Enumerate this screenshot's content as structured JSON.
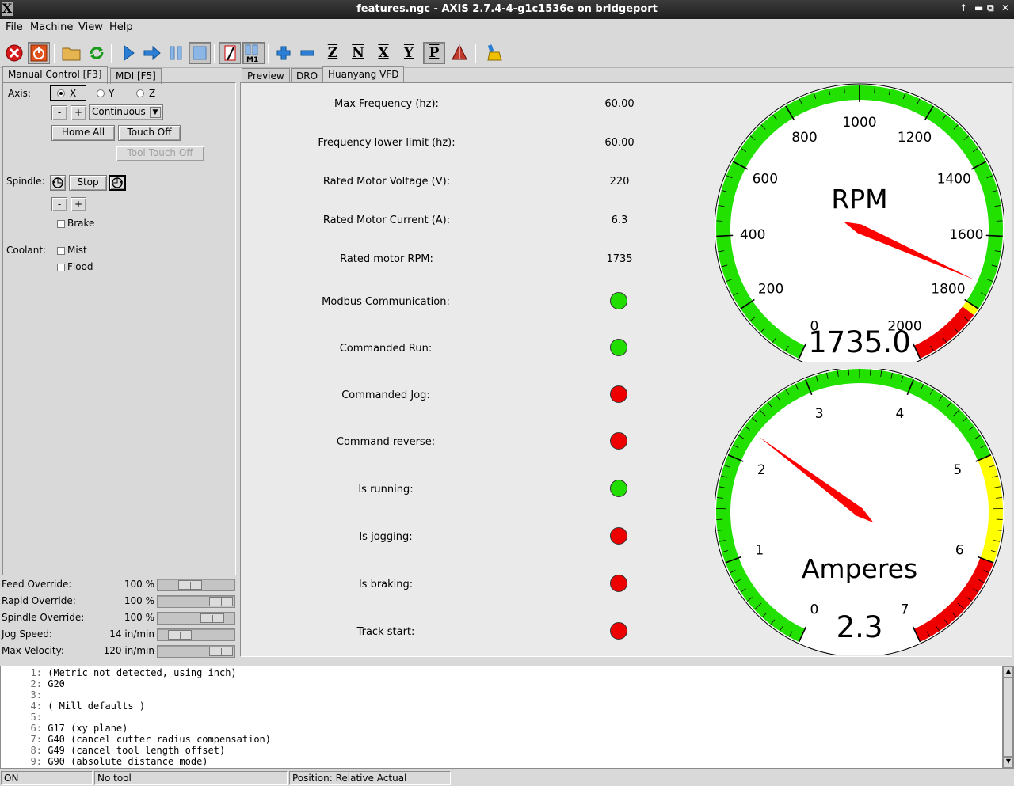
{
  "window": {
    "title": "features.ngc - AXIS 2.7.4-4-g1c1536e on bridgeport",
    "x_logo": "X"
  },
  "menu": [
    {
      "label": "File"
    },
    {
      "label": "Machine"
    },
    {
      "label": "View"
    },
    {
      "label": "Help"
    }
  ],
  "left_tabs": [
    {
      "label": "Manual Control [F3]"
    },
    {
      "label": "MDI [F5]"
    }
  ],
  "right_tabs": [
    {
      "label": "Preview"
    },
    {
      "label": "DRO"
    },
    {
      "label": "Huanyang VFD"
    }
  ],
  "manual": {
    "axis_label": "Axis:",
    "axes": [
      {
        "label": "X",
        "selected": true
      },
      {
        "label": "Y",
        "selected": false
      },
      {
        "label": "Z",
        "selected": false
      }
    ],
    "jog_minus": "-",
    "jog_plus": "+",
    "jog_mode": "Continuous",
    "home_all": "Home All",
    "touch_off": "Touch Off",
    "tool_touch_off": "Tool Touch Off",
    "spindle_label": "Spindle:",
    "spindle_stop": "Stop",
    "spindle_minus": "-",
    "spindle_plus": "+",
    "brake": "Brake",
    "coolant_label": "Coolant:",
    "mist": "Mist",
    "flood": "Flood"
  },
  "overrides": [
    {
      "label": "Feed Override:",
      "value": "100 %",
      "fraction": 0.4
    },
    {
      "label": "Rapid Override:",
      "value": "100 %",
      "fraction": 1.0
    },
    {
      "label": "Spindle Override:",
      "value": "100 %",
      "fraction": 0.83
    },
    {
      "label": "Jog Speed:",
      "value": "14 in/min",
      "fraction": 0.2
    },
    {
      "label": "Max Velocity:",
      "value": "120 in/min",
      "fraction": 1.0
    }
  ],
  "vfd": {
    "params": [
      {
        "label": "Max Frequency (hz):",
        "value": "60.00"
      },
      {
        "label": "Frequency lower limit (hz):",
        "value": "60.00"
      },
      {
        "label": "Rated Motor Voltage (V):",
        "value": "220"
      },
      {
        "label": "Rated Motor Current (A):",
        "value": "6.3"
      },
      {
        "label": "Rated motor RPM:",
        "value": "1735"
      }
    ],
    "leds": [
      {
        "label": "Modbus Communication:",
        "state": "on"
      },
      {
        "label": "Commanded Run:",
        "state": "on"
      },
      {
        "label": "Commanded Jog:",
        "state": "off"
      },
      {
        "label": "Command reverse:",
        "state": "off"
      },
      {
        "label": "Is running:",
        "state": "on"
      },
      {
        "label": "Is jogging:",
        "state": "off"
      },
      {
        "label": "Is braking:",
        "state": "off"
      },
      {
        "label": "Track start:",
        "state": "off"
      }
    ],
    "led_colors": {
      "on": "#22dd00",
      "off": "#ee0000"
    }
  },
  "gauges": {
    "rpm": {
      "title": "RPM",
      "readout": "1735.0",
      "value": 1735,
      "min": 0,
      "max": 2000,
      "major_step": 200,
      "minor_per_major": 5,
      "labels": [
        "0",
        "200",
        "400",
        "600",
        "800",
        "1000",
        "1200",
        "1400",
        "1600",
        "1800",
        "2000"
      ],
      "zones": [
        {
          "from": 0,
          "to": 1800,
          "color": "#22e000"
        },
        {
          "from": 1800,
          "to": 1820,
          "color": "#ffff00"
        },
        {
          "from": 1820,
          "to": 2000,
          "color": "#ee0000"
        }
      ]
    },
    "amps": {
      "title": "Amperes",
      "readout": "2.3",
      "value": 2.3,
      "min": 0,
      "max": 7,
      "major_step": 1,
      "minor_per_major": 10,
      "labels": [
        "0",
        "1",
        "2",
        "3",
        "4",
        "5",
        "6",
        "7"
      ],
      "zones": [
        {
          "from": 0,
          "to": 5,
          "color": "#22e000"
        },
        {
          "from": 5,
          "to": 6,
          "color": "#ffff00"
        },
        {
          "from": 6,
          "to": 7,
          "color": "#ee0000"
        }
      ]
    }
  },
  "gcode": [
    {
      "n": "1:",
      "text": "(Metric not detected, using inch)"
    },
    {
      "n": "2:",
      "text": "G20"
    },
    {
      "n": "3:",
      "text": ""
    },
    {
      "n": "4:",
      "text": "( Mill defaults )"
    },
    {
      "n": "5:",
      "text": ""
    },
    {
      "n": "6:",
      "text": "G17 (xy plane)"
    },
    {
      "n": "7:",
      "text": "G40 (cancel cutter radius compensation)"
    },
    {
      "n": "8:",
      "text": "G49 (cancel tool length offset)"
    },
    {
      "n": "9:",
      "text": "G90 (absolute distance mode)"
    }
  ],
  "status": {
    "machine": "ON",
    "tool": "No tool",
    "position": "Position: Relative Actual"
  }
}
